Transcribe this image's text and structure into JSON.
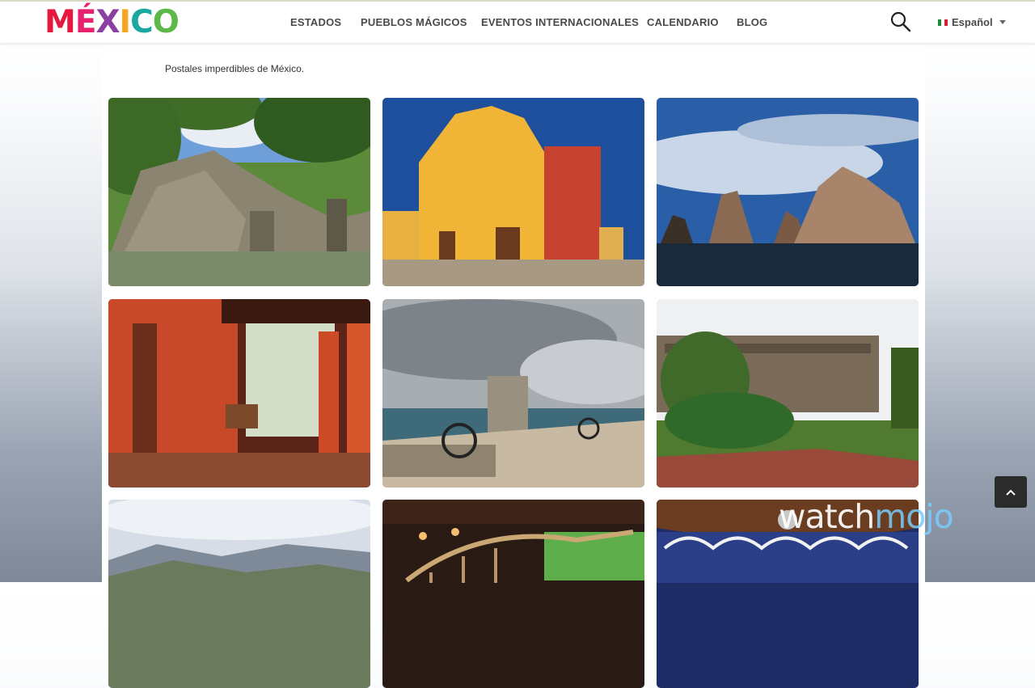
{
  "header": {
    "logo_letters": [
      {
        "char": "M",
        "color": "#e5193f"
      },
      {
        "char": "É",
        "color": "#e8206e"
      },
      {
        "char": "X",
        "color": "#8b3fa0"
      },
      {
        "char": "I",
        "color": "#f5a623"
      },
      {
        "char": "C",
        "color": "#1aa8a0"
      },
      {
        "char": "O",
        "color": "#5cb848"
      }
    ],
    "nav": [
      "ESTADOS",
      "PUEBLOS MÁGICOS",
      "EVENTOS INTERNACIONALES",
      "CALENDARIO",
      "BLOG"
    ],
    "search_icon": "search-icon",
    "language": "Español"
  },
  "page": {
    "subtitle": "Postales imperdibles de México."
  },
  "gallery": [
    {
      "subject": "maya-ruins-photo"
    },
    {
      "subject": "cathedral-photo"
    },
    {
      "subject": "arch-rocks-photo"
    },
    {
      "subject": "hacienda-corridor-photo"
    },
    {
      "subject": "fort-cannons-photo"
    },
    {
      "subject": "castle-garden-photo"
    },
    {
      "subject": "canyon-photo"
    },
    {
      "subject": "dinosaur-skeleton-photo"
    },
    {
      "subject": "kiosk-photo"
    }
  ],
  "back_to_top_icon": "chevron-up-icon",
  "watermark": {
    "part1": "watch",
    "part2": "mojo"
  }
}
